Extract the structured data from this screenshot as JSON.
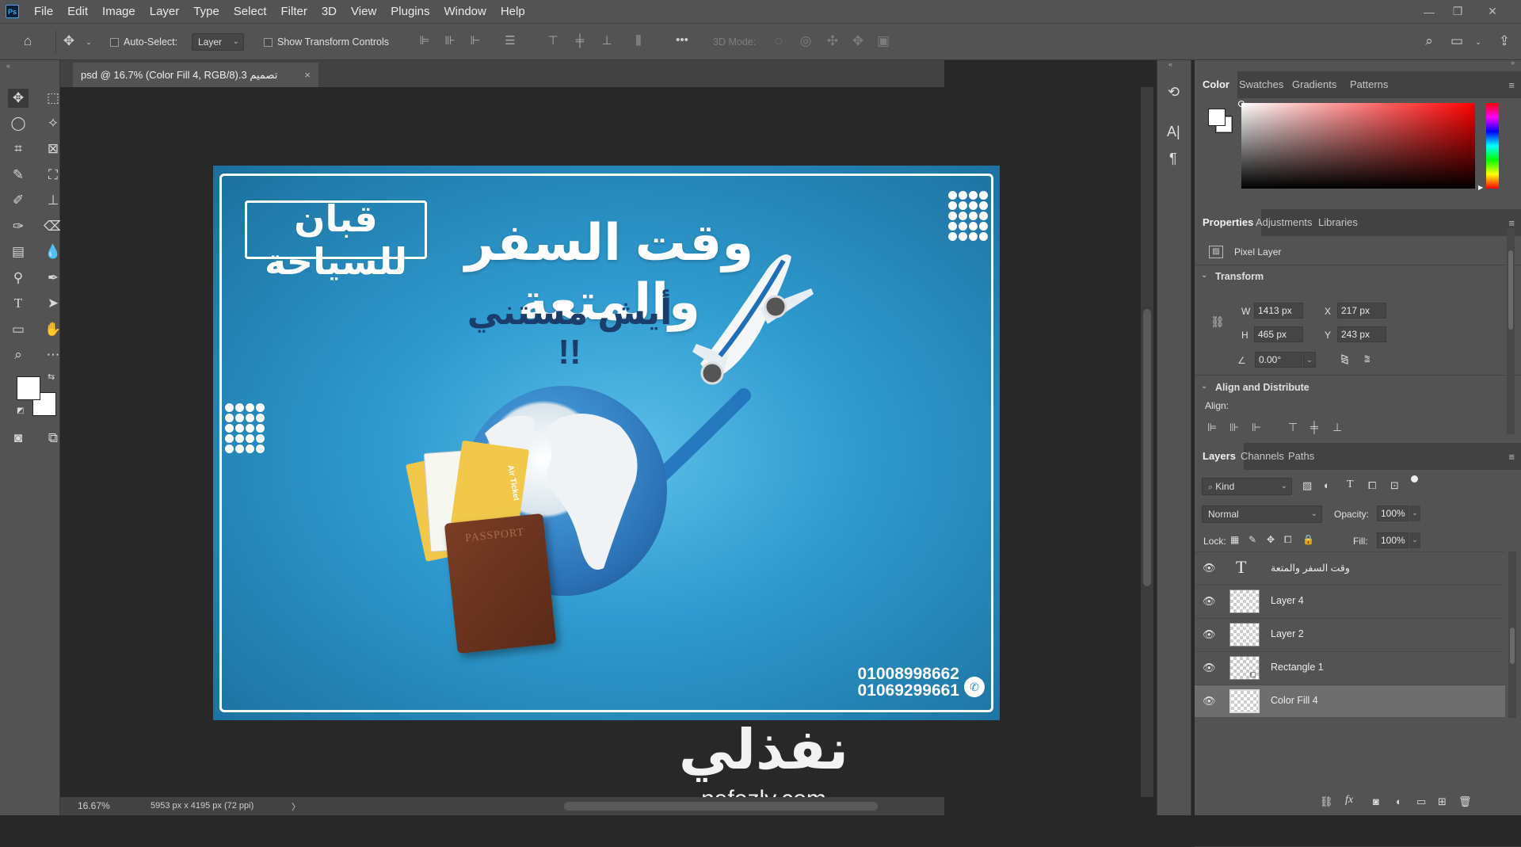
{
  "app": {
    "logo": "Ps"
  },
  "menu": [
    "File",
    "Edit",
    "Image",
    "Layer",
    "Type",
    "Select",
    "Filter",
    "3D",
    "View",
    "Plugins",
    "Window",
    "Help"
  ],
  "window_controls": {
    "minimize": "—",
    "restore": "❐",
    "close": "✕"
  },
  "options": {
    "auto_select_label": "Auto-Select:",
    "auto_select_value": "Layer",
    "show_transform_label": "Show Transform Controls",
    "mode_3d_label": "3D Mode:",
    "more": "•••"
  },
  "document": {
    "tab_title": "تصميم 3.psd @ 16.7% (Color Fill 4, RGB/8)",
    "close": "×",
    "zoom": "16.67%",
    "doc_info": "5953 px x 4195 px (72 ppi)",
    "arrow": "〉"
  },
  "artwork": {
    "brand": "قبان للسياحة",
    "headline": "وقت السفر والمتعة",
    "subheadline": "أيش مستني !!",
    "phone1": "01008998662",
    "phone2": "01069299661",
    "passport": "PASSPORT",
    "ticket": "Air Ticket",
    "colors": {
      "background": "#2f9bd0",
      "frame": "#ffffff",
      "passport": "#6b3420"
    }
  },
  "watermark": {
    "arabic": "نفذلي",
    "latin": "nafezly.com"
  },
  "color_panel": {
    "tabs": [
      "Color",
      "Swatches",
      "Gradients",
      "Patterns"
    ],
    "active": "Color",
    "hue": "#ff0000"
  },
  "properties": {
    "tabs": [
      "Properties",
      "Adjustments",
      "Libraries"
    ],
    "active": "Properties",
    "layer_type": "Pixel Layer",
    "transform_title": "Transform",
    "w_label": "W",
    "w_value": "1413 px",
    "h_label": "H",
    "h_value": "465 px",
    "x_label": "X",
    "x_value": "217 px",
    "y_label": "Y",
    "y_value": "243 px",
    "angle_value": "0.00°",
    "align_title": "Align and Distribute",
    "align_label": "Align:"
  },
  "layers_panel": {
    "tabs": [
      "Layers",
      "Channels",
      "Paths"
    ],
    "active": "Layers",
    "filter_kind": "Kind",
    "blend_mode": "Normal",
    "opacity_label": "Opacity:",
    "opacity_value": "100%",
    "lock_label": "Lock:",
    "fill_label": "Fill:",
    "fill_value": "100%",
    "layers": [
      {
        "name": "وقت السفر والمتعة",
        "kind": "text",
        "selected": false
      },
      {
        "name": "Layer 4",
        "kind": "pixel",
        "selected": false
      },
      {
        "name": "Layer 2",
        "kind": "pixel",
        "selected": false
      },
      {
        "name": "Rectangle 1",
        "kind": "shape",
        "selected": false
      },
      {
        "name": "Color Fill 4",
        "kind": "fill",
        "selected": true
      }
    ],
    "footer_fx": "fx"
  }
}
